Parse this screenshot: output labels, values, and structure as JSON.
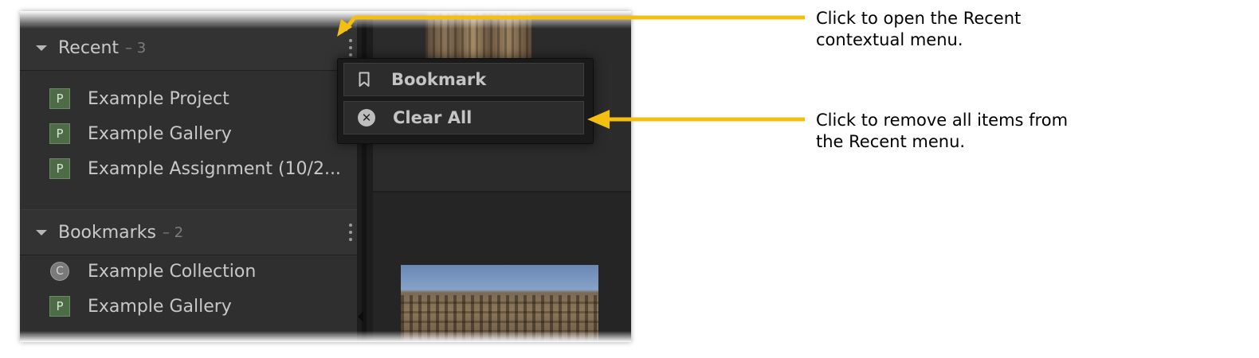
{
  "sidebar": {
    "recent": {
      "title": "Recent",
      "count": "– 3",
      "items": [
        {
          "badge": "P",
          "label": "Example Project"
        },
        {
          "badge": "P",
          "label": "Example Gallery"
        },
        {
          "badge": "P",
          "label": "Example Assignment (10/2..."
        }
      ]
    },
    "bookmarks": {
      "title": "Bookmarks",
      "count": "– 2",
      "items": [
        {
          "badge": "C",
          "label": "Example Collection"
        },
        {
          "badge": "P",
          "label": "Example Gallery"
        }
      ]
    }
  },
  "menu": {
    "bookmark_label": "Bookmark",
    "clear_all_label": "Clear All"
  },
  "callouts": {
    "open_menu": "Click to open the Recent\ncontextual menu.",
    "clear_all": "Click to remove all items from\nthe Recent menu."
  },
  "colors": {
    "arrow": "#f5bf12",
    "panel": "#2f2f2f",
    "badge_project": "#4e6b47"
  },
  "icons": {
    "collapse": "triangle-down-icon",
    "more": "vertical-ellipsis-icon",
    "bookmark": "bookmark-icon",
    "clear": "x-circle-icon"
  }
}
